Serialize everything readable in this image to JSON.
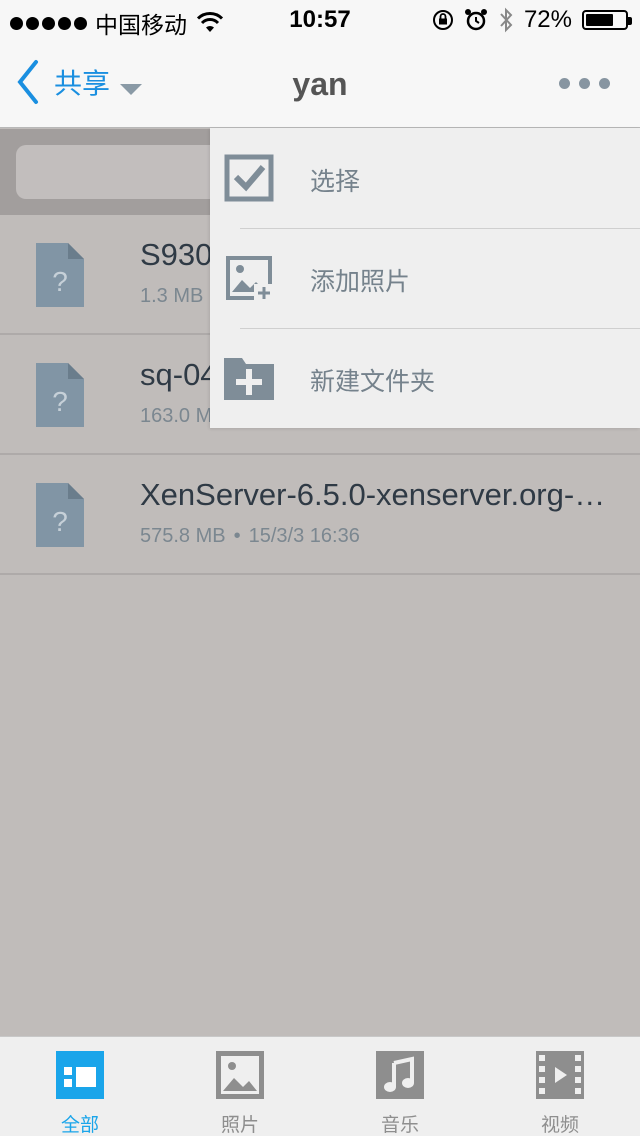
{
  "status_bar": {
    "carrier": "中国移动",
    "time": "10:57",
    "battery": "72%",
    "battery_level": 0.72
  },
  "nav": {
    "back_label": "共享",
    "title": "yan"
  },
  "search": {
    "placeholder": ""
  },
  "files": [
    {
      "name": "S930",
      "size": "1.3 MB",
      "date": ""
    },
    {
      "name": "sq-04",
      "size": "163.0 M",
      "date": ""
    },
    {
      "name": "XenServer-6.5.0-xenserver.org-…",
      "size": "575.8 MB",
      "date": "15/3/3 16:36"
    }
  ],
  "menu": {
    "items": [
      {
        "label": "选择",
        "icon": "checkbox-icon"
      },
      {
        "label": "添加照片",
        "icon": "add-photo-icon"
      },
      {
        "label": "新建文件夹",
        "icon": "new-folder-icon"
      }
    ]
  },
  "tabs": [
    {
      "label": "全部",
      "icon": "all-files-icon",
      "active": true
    },
    {
      "label": "照片",
      "icon": "photos-icon",
      "active": false
    },
    {
      "label": "音乐",
      "icon": "music-icon",
      "active": false
    },
    {
      "label": "视频",
      "icon": "video-icon",
      "active": false
    }
  ],
  "colors": {
    "accent": "#1aa5ea",
    "nav_link": "#1a8fe0",
    "icon_gray": "#8795a1",
    "file_icon": "#8195a5",
    "overlay_bg": "#c0bcba"
  }
}
